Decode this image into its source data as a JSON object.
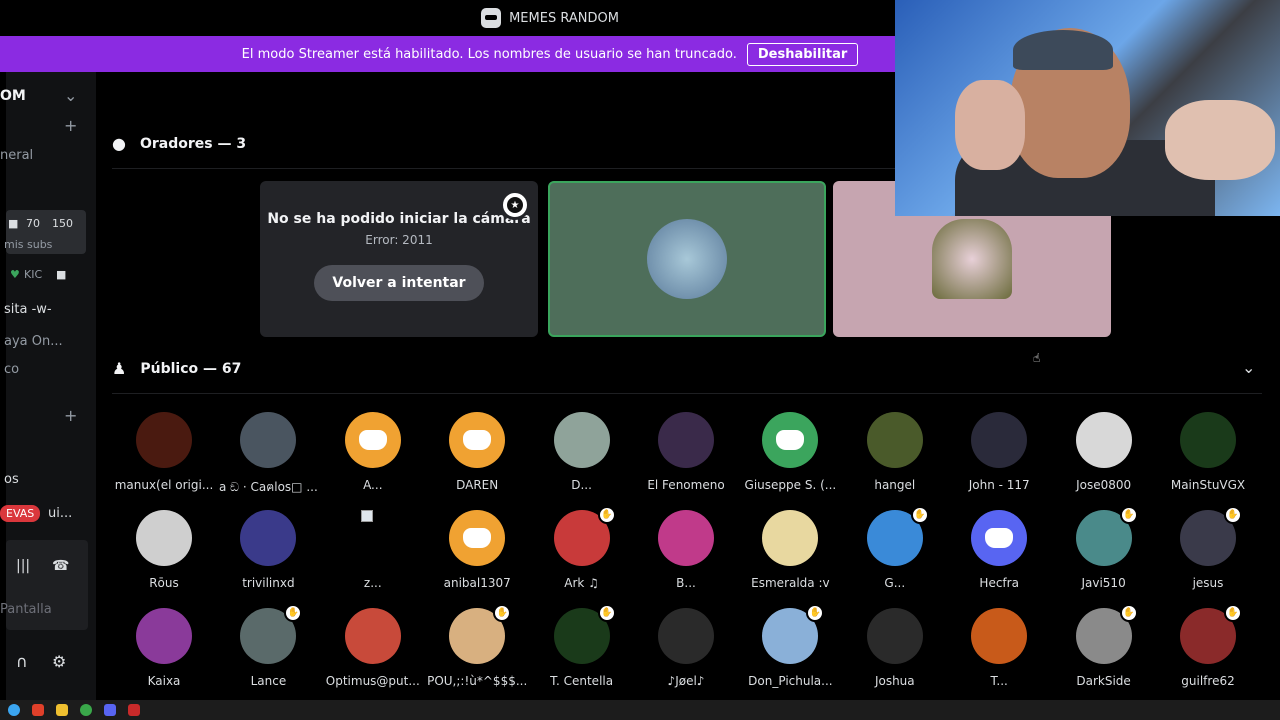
{
  "window": {
    "title": "MEMES RANDOM"
  },
  "banner": {
    "text": "El modo Streamer está habilitado. Los nombres de usuario se han truncado.",
    "button": "Deshabilitar",
    "color": "#8b2be2"
  },
  "sidebar": {
    "server_name": "OM",
    "rows": [
      "neral",
      "70",
      "150",
      "mis subs",
      "KIC",
      "sita -w-",
      "aya On...",
      "co",
      "os",
      "EVAS",
      "ui...",
      "Pantalla"
    ]
  },
  "speakers": {
    "title": "Oradores — 3",
    "error_title": "No se ha podido iniciar la cámara",
    "error_code": "Error: 2011",
    "retry": "Volver a intentar"
  },
  "audience": {
    "title": "Público — 67",
    "members": [
      {
        "name": "manux(el origi...",
        "color": "#4a1a10",
        "icon": "avatar",
        "hand": false
      },
      {
        "name": "a ඞ · Caฅlos□ ...",
        "color": "#4a5560",
        "icon": "avatar",
        "hand": false
      },
      {
        "name": "A...",
        "color": "#f0a232",
        "icon": "discord",
        "hand": false
      },
      {
        "name": "DAREN",
        "color": "#f0a232",
        "icon": "discord",
        "hand": false
      },
      {
        "name": "D...",
        "color": "#8fa39a",
        "icon": "avatar",
        "hand": false
      },
      {
        "name": "El Fenomeno",
        "color": "#3a2a4a",
        "icon": "avatar",
        "hand": false
      },
      {
        "name": "Giuseppe S. (...",
        "color": "#3ba55d",
        "icon": "discord",
        "hand": false
      },
      {
        "name": "hangel",
        "color": "#4a5a2a",
        "icon": "avatar",
        "hand": false
      },
      {
        "name": "John - 117",
        "color": "#2a2a3a",
        "icon": "avatar",
        "hand": false
      },
      {
        "name": "Jose0800",
        "color": "#d8d8d8",
        "icon": "avatar",
        "hand": false
      },
      {
        "name": "MainStuVGX",
        "color": "#1a3a1a",
        "icon": "avatar",
        "hand": false
      },
      {
        "name": "Rōus",
        "color": "#cfcfcf",
        "icon": "avatar",
        "hand": false
      },
      {
        "name": "trivilinxd",
        "color": "#3a3a8a",
        "icon": "avatar",
        "hand": false
      },
      {
        "name": "z...",
        "color": "#000000",
        "icon": "broken",
        "hand": false
      },
      {
        "name": "anibal1307",
        "color": "#f0a232",
        "icon": "discord",
        "hand": false
      },
      {
        "name": "Ark ♫",
        "color": "#c83a3a",
        "icon": "avatar",
        "hand": true
      },
      {
        "name": "B...",
        "color": "#c03a8a",
        "icon": "avatar",
        "hand": false
      },
      {
        "name": "Esmeralda :v",
        "color": "#e8d8a0",
        "icon": "avatar",
        "hand": false
      },
      {
        "name": "G...",
        "color": "#3a8ad8",
        "icon": "avatar",
        "hand": true
      },
      {
        "name": "Hecfra",
        "color": "#5865f2",
        "icon": "discord",
        "hand": false
      },
      {
        "name": "Javi510",
        "color": "#4a8a8a",
        "icon": "avatar",
        "hand": true
      },
      {
        "name": "jesus",
        "color": "#3a3a4a",
        "icon": "avatar",
        "hand": true
      },
      {
        "name": "Kaixa",
        "color": "#8a3a9a",
        "icon": "avatar",
        "hand": false
      },
      {
        "name": "Lance",
        "color": "#5a6a6a",
        "icon": "avatar",
        "hand": true
      },
      {
        "name": "Optimus@put...",
        "color": "#c84a3a",
        "icon": "avatar",
        "hand": false
      },
      {
        "name": "POU,;:!ù*^$$$...",
        "color": "#d8b080",
        "icon": "avatar",
        "hand": true
      },
      {
        "name": "T. Centella",
        "color": "#1a3a1a",
        "icon": "avatar",
        "hand": true
      },
      {
        "name": "♪Jøel♪",
        "color": "#2a2a2a",
        "icon": "avatar",
        "hand": false
      },
      {
        "name": "Don_Pichula...",
        "color": "#8ab0d8",
        "icon": "avatar",
        "hand": true
      },
      {
        "name": "Joshua",
        "color": "#2a2a2a",
        "icon": "avatar",
        "hand": false
      },
      {
        "name": "T...",
        "color": "#c85a1a",
        "icon": "avatar",
        "hand": false
      },
      {
        "name": "DarkSide",
        "color": "#8a8a8a",
        "icon": "avatar",
        "hand": true
      },
      {
        "name": "guilfre62",
        "color": "#8a2a2a",
        "icon": "avatar",
        "hand": true
      }
    ]
  }
}
